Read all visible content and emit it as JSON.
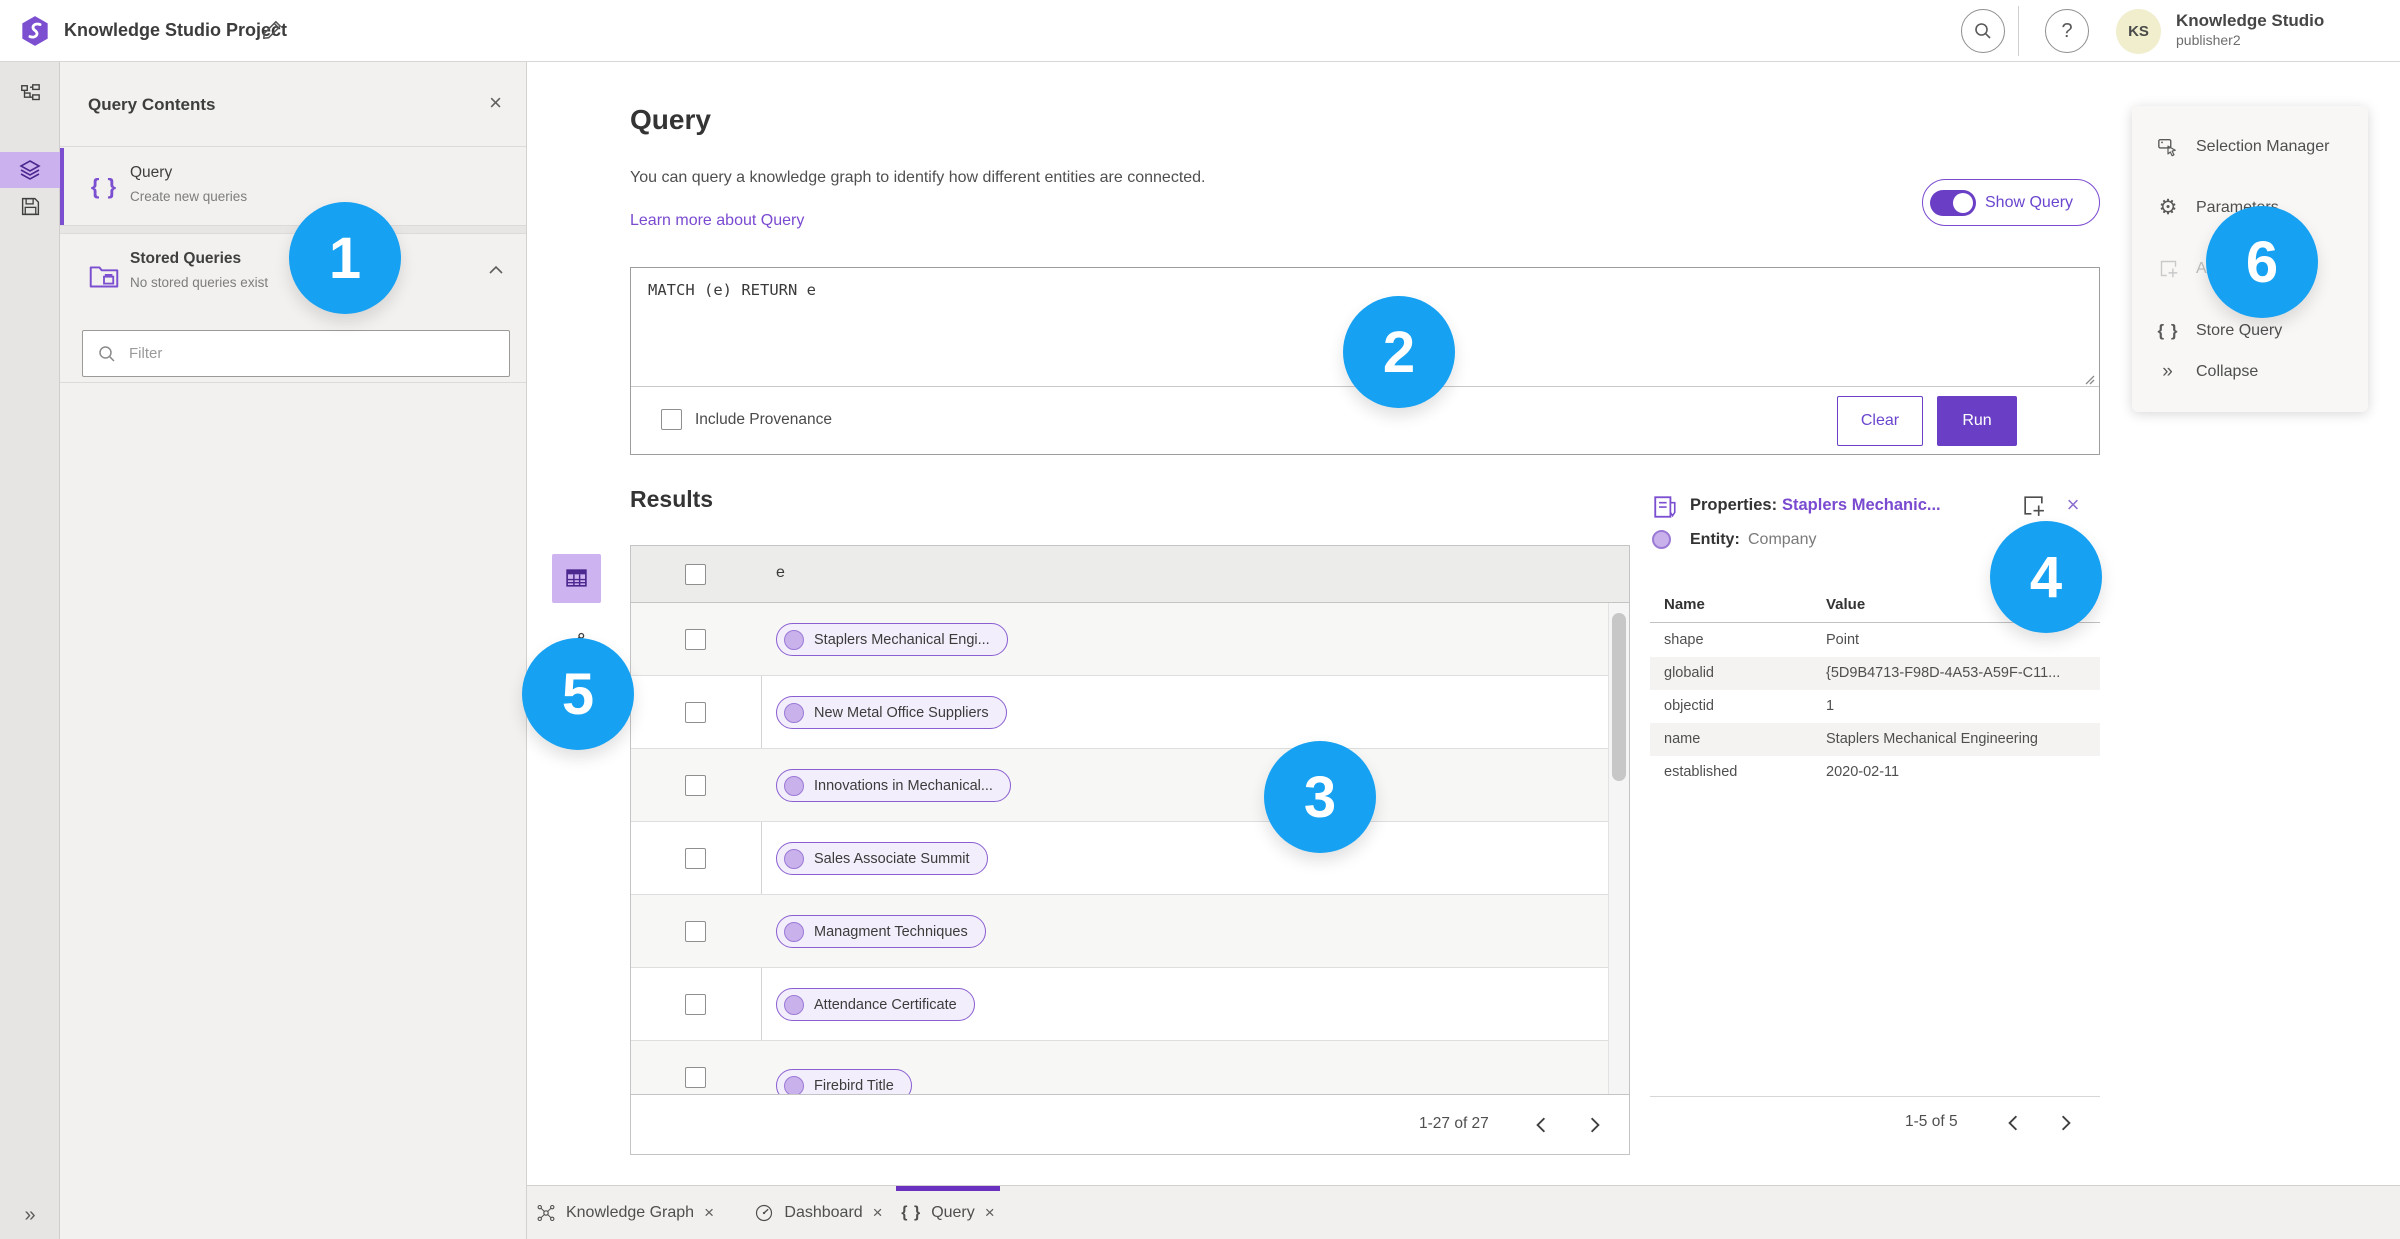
{
  "colors": {
    "accent_purple": "#6a3fc6",
    "link_purple": "#7a4ad0",
    "selected_light_purple": "#cdb4f0",
    "pill_border": "#8a5fd1",
    "pill_fill": "#f3eefb",
    "node_fill": "#c9b1ec",
    "badge_blue": "#16a1f3",
    "avatar_bg": "#f0eecd"
  },
  "glyphs": {
    "close": "×",
    "braces": "{ }",
    "expand": "»",
    "help": "?"
  },
  "header": {
    "title": "Knowledge Studio Project",
    "user_initials": "KS",
    "app_name": "Knowledge Studio",
    "username": "publisher2"
  },
  "query_contents": {
    "title": "Query Contents",
    "query_item": {
      "title": "Query",
      "subtitle": "Create new queries"
    },
    "stored_item": {
      "title": "Stored Queries",
      "subtitle": "No stored queries exist"
    },
    "filter_placeholder": "Filter"
  },
  "query_panel": {
    "title": "Query",
    "description": "You can query a knowledge graph to identify how different entities are connected.",
    "learn_more": "Learn more about Query",
    "show_query": "Show Query",
    "query_text": "MATCH (e) RETURN e",
    "include_provenance": "Include Provenance",
    "clear": "Clear",
    "run": "Run"
  },
  "results": {
    "title": "Results",
    "column": "e",
    "rows": [
      "Staplers Mechanical Engi...",
      "New Metal Office Suppliers",
      "Innovations in Mechanical...",
      "Sales Associate Summit",
      "Managment Techniques",
      "Attendance Certificate",
      "Firebird Title"
    ],
    "pagination": "1-27 of 27"
  },
  "properties": {
    "label": "Properties:",
    "link": "Staplers Mechanic...",
    "entity_label": "Entity:",
    "entity_value": "Company",
    "col_name": "Name",
    "col_value": "Value",
    "rows": [
      {
        "name": "shape",
        "value": "Point"
      },
      {
        "name": "globalid",
        "value": "{5D9B4713-F98D-4A53-A59F-C11..."
      },
      {
        "name": "objectid",
        "value": "1"
      },
      {
        "name": "name",
        "value": "Staplers Mechanical Engineering"
      },
      {
        "name": "established",
        "value": "2020-02-11"
      }
    ],
    "pagination": "1-5 of 5"
  },
  "right_menu": {
    "items": [
      {
        "label": "Selection Manager"
      },
      {
        "label": "Parameters"
      },
      {
        "label": "Ad"
      },
      {
        "label": "Store Query"
      },
      {
        "label": "Collapse"
      }
    ]
  },
  "tabs": [
    {
      "label": "Knowledge Graph"
    },
    {
      "label": "Dashboard"
    },
    {
      "label": "Query"
    }
  ],
  "annotations": [
    "1",
    "2",
    "3",
    "4",
    "5",
    "6"
  ]
}
